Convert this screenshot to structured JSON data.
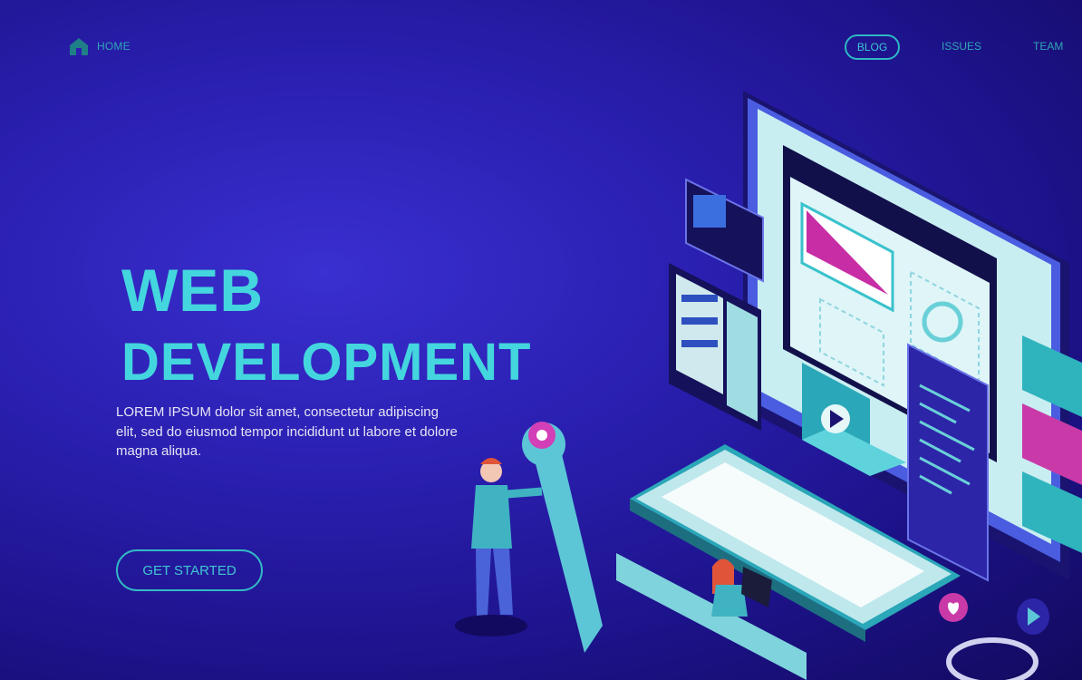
{
  "nav": {
    "home_label": "HOME",
    "links": [
      {
        "label": "BLOG",
        "active": true
      },
      {
        "label": "ISSUES",
        "active": false
      },
      {
        "label": "TEAM",
        "active": false
      }
    ]
  },
  "hero": {
    "title_line1": "WEB",
    "title_line2": "DEVELOPMENT",
    "description": "LOREM IPSUM dolor sit amet, consectetur adipiscing elit, sed do eiusmod tempor incididunt ut labore et dolore magna aliqua.",
    "cta_label": "GET STARTED"
  },
  "colors": {
    "accent": "#3fc6d2",
    "background": "#2a1fb0",
    "magenta": "#d63fb6"
  },
  "icons": [
    "home-icon",
    "gear-icon",
    "play-icon",
    "heart-icon"
  ]
}
